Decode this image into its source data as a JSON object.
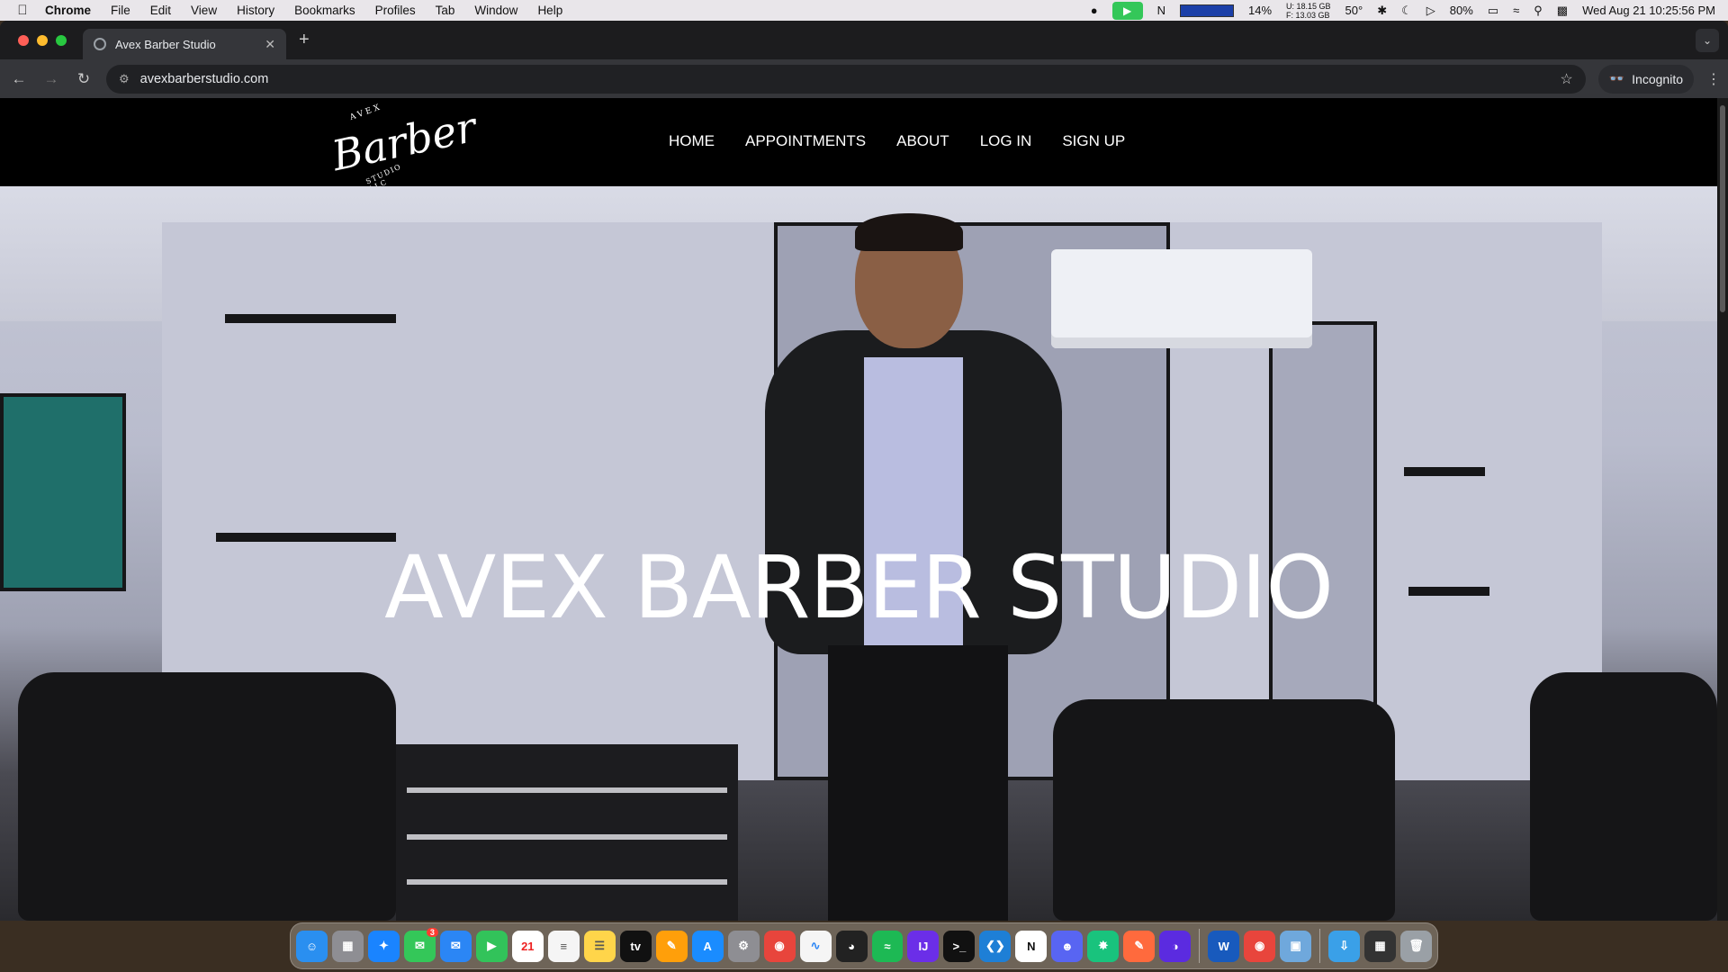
{
  "system_menubar": {
    "app_name": "Chrome",
    "menus": [
      "File",
      "Edit",
      "View",
      "History",
      "Bookmarks",
      "Profiles",
      "Tab",
      "Window",
      "Help"
    ],
    "cpu_percent": "14%",
    "memory_used": "U: 18.15 GB",
    "memory_free": "F: 13.03 GB",
    "temperature": "50°",
    "battery": "80%",
    "datetime": "Wed Aug 21  10:25:56 PM"
  },
  "browser": {
    "tab_title": "Avex Barber Studio",
    "url": "avexbarberstudio.com",
    "profile_label": "Incognito"
  },
  "site": {
    "logo": {
      "top": "AVEX",
      "script": "Barber",
      "bottom": "STUDIO LLC"
    },
    "nav": [
      "HOME",
      "APPOINTMENTS",
      "ABOUT",
      "LOG IN",
      "SIGN UP"
    ],
    "hero_title": "AVEX BARBER STUDIO"
  },
  "dock": {
    "apps": [
      "finder",
      "launchpad",
      "safari",
      "messages",
      "mail",
      "facetime",
      "calendar",
      "reminders",
      "notes",
      "apple-tv",
      "pages",
      "app-store",
      "system-settings",
      "chrome",
      "freeform",
      "activity",
      "spotify",
      "intellij",
      "terminal",
      "vscode",
      "notion",
      "discord",
      "chatgpt",
      "affinity",
      "proton",
      "word",
      "chrome-2",
      "preview",
      "downloads",
      "keyboard-viewer",
      "trash"
    ],
    "calendar_day": "21",
    "messages_badge": "3",
    "colors": {
      "finder": "#2a8ff0",
      "safari": "#1a84ff",
      "messages": "#34c759",
      "mail": "#2b86f5",
      "facetime": "#32c35a",
      "spotify": "#1db954",
      "vscode": "#1e7fd6",
      "discord": "#5865f2",
      "word": "#185abd",
      "chrome": "#e8453c"
    }
  }
}
